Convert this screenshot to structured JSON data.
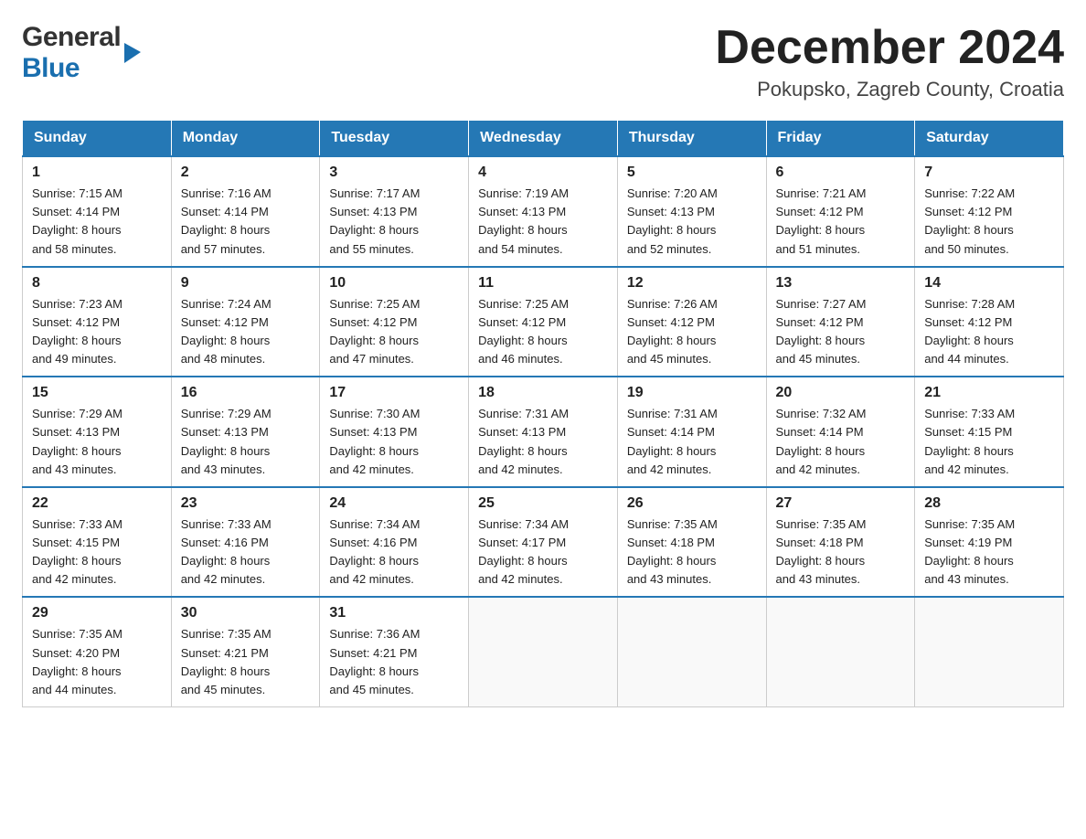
{
  "header": {
    "logo_general": "General",
    "logo_blue": "Blue",
    "month_title": "December 2024",
    "location": "Pokupsko, Zagreb County, Croatia"
  },
  "days_of_week": [
    "Sunday",
    "Monday",
    "Tuesday",
    "Wednesday",
    "Thursday",
    "Friday",
    "Saturday"
  ],
  "weeks": [
    [
      {
        "day": "1",
        "sunrise": "7:15 AM",
        "sunset": "4:14 PM",
        "daylight": "8 hours and 58 minutes."
      },
      {
        "day": "2",
        "sunrise": "7:16 AM",
        "sunset": "4:14 PM",
        "daylight": "8 hours and 57 minutes."
      },
      {
        "day": "3",
        "sunrise": "7:17 AM",
        "sunset": "4:13 PM",
        "daylight": "8 hours and 55 minutes."
      },
      {
        "day": "4",
        "sunrise": "7:19 AM",
        "sunset": "4:13 PM",
        "daylight": "8 hours and 54 minutes."
      },
      {
        "day": "5",
        "sunrise": "7:20 AM",
        "sunset": "4:13 PM",
        "daylight": "8 hours and 52 minutes."
      },
      {
        "day": "6",
        "sunrise": "7:21 AM",
        "sunset": "4:12 PM",
        "daylight": "8 hours and 51 minutes."
      },
      {
        "day": "7",
        "sunrise": "7:22 AM",
        "sunset": "4:12 PM",
        "daylight": "8 hours and 50 minutes."
      }
    ],
    [
      {
        "day": "8",
        "sunrise": "7:23 AM",
        "sunset": "4:12 PM",
        "daylight": "8 hours and 49 minutes."
      },
      {
        "day": "9",
        "sunrise": "7:24 AM",
        "sunset": "4:12 PM",
        "daylight": "8 hours and 48 minutes."
      },
      {
        "day": "10",
        "sunrise": "7:25 AM",
        "sunset": "4:12 PM",
        "daylight": "8 hours and 47 minutes."
      },
      {
        "day": "11",
        "sunrise": "7:25 AM",
        "sunset": "4:12 PM",
        "daylight": "8 hours and 46 minutes."
      },
      {
        "day": "12",
        "sunrise": "7:26 AM",
        "sunset": "4:12 PM",
        "daylight": "8 hours and 45 minutes."
      },
      {
        "day": "13",
        "sunrise": "7:27 AM",
        "sunset": "4:12 PM",
        "daylight": "8 hours and 45 minutes."
      },
      {
        "day": "14",
        "sunrise": "7:28 AM",
        "sunset": "4:12 PM",
        "daylight": "8 hours and 44 minutes."
      }
    ],
    [
      {
        "day": "15",
        "sunrise": "7:29 AM",
        "sunset": "4:13 PM",
        "daylight": "8 hours and 43 minutes."
      },
      {
        "day": "16",
        "sunrise": "7:29 AM",
        "sunset": "4:13 PM",
        "daylight": "8 hours and 43 minutes."
      },
      {
        "day": "17",
        "sunrise": "7:30 AM",
        "sunset": "4:13 PM",
        "daylight": "8 hours and 42 minutes."
      },
      {
        "day": "18",
        "sunrise": "7:31 AM",
        "sunset": "4:13 PM",
        "daylight": "8 hours and 42 minutes."
      },
      {
        "day": "19",
        "sunrise": "7:31 AM",
        "sunset": "4:14 PM",
        "daylight": "8 hours and 42 minutes."
      },
      {
        "day": "20",
        "sunrise": "7:32 AM",
        "sunset": "4:14 PM",
        "daylight": "8 hours and 42 minutes."
      },
      {
        "day": "21",
        "sunrise": "7:33 AM",
        "sunset": "4:15 PM",
        "daylight": "8 hours and 42 minutes."
      }
    ],
    [
      {
        "day": "22",
        "sunrise": "7:33 AM",
        "sunset": "4:15 PM",
        "daylight": "8 hours and 42 minutes."
      },
      {
        "day": "23",
        "sunrise": "7:33 AM",
        "sunset": "4:16 PM",
        "daylight": "8 hours and 42 minutes."
      },
      {
        "day": "24",
        "sunrise": "7:34 AM",
        "sunset": "4:16 PM",
        "daylight": "8 hours and 42 minutes."
      },
      {
        "day": "25",
        "sunrise": "7:34 AM",
        "sunset": "4:17 PM",
        "daylight": "8 hours and 42 minutes."
      },
      {
        "day": "26",
        "sunrise": "7:35 AM",
        "sunset": "4:18 PM",
        "daylight": "8 hours and 43 minutes."
      },
      {
        "day": "27",
        "sunrise": "7:35 AM",
        "sunset": "4:18 PM",
        "daylight": "8 hours and 43 minutes."
      },
      {
        "day": "28",
        "sunrise": "7:35 AM",
        "sunset": "4:19 PM",
        "daylight": "8 hours and 43 minutes."
      }
    ],
    [
      {
        "day": "29",
        "sunrise": "7:35 AM",
        "sunset": "4:20 PM",
        "daylight": "8 hours and 44 minutes."
      },
      {
        "day": "30",
        "sunrise": "7:35 AM",
        "sunset": "4:21 PM",
        "daylight": "8 hours and 45 minutes."
      },
      {
        "day": "31",
        "sunrise": "7:36 AM",
        "sunset": "4:21 PM",
        "daylight": "8 hours and 45 minutes."
      },
      null,
      null,
      null,
      null
    ]
  ],
  "labels": {
    "sunrise": "Sunrise:",
    "sunset": "Sunset:",
    "daylight": "Daylight:"
  },
  "colors": {
    "header_bg": "#2578b5",
    "header_text": "#ffffff",
    "border_top": "#2578b5"
  }
}
